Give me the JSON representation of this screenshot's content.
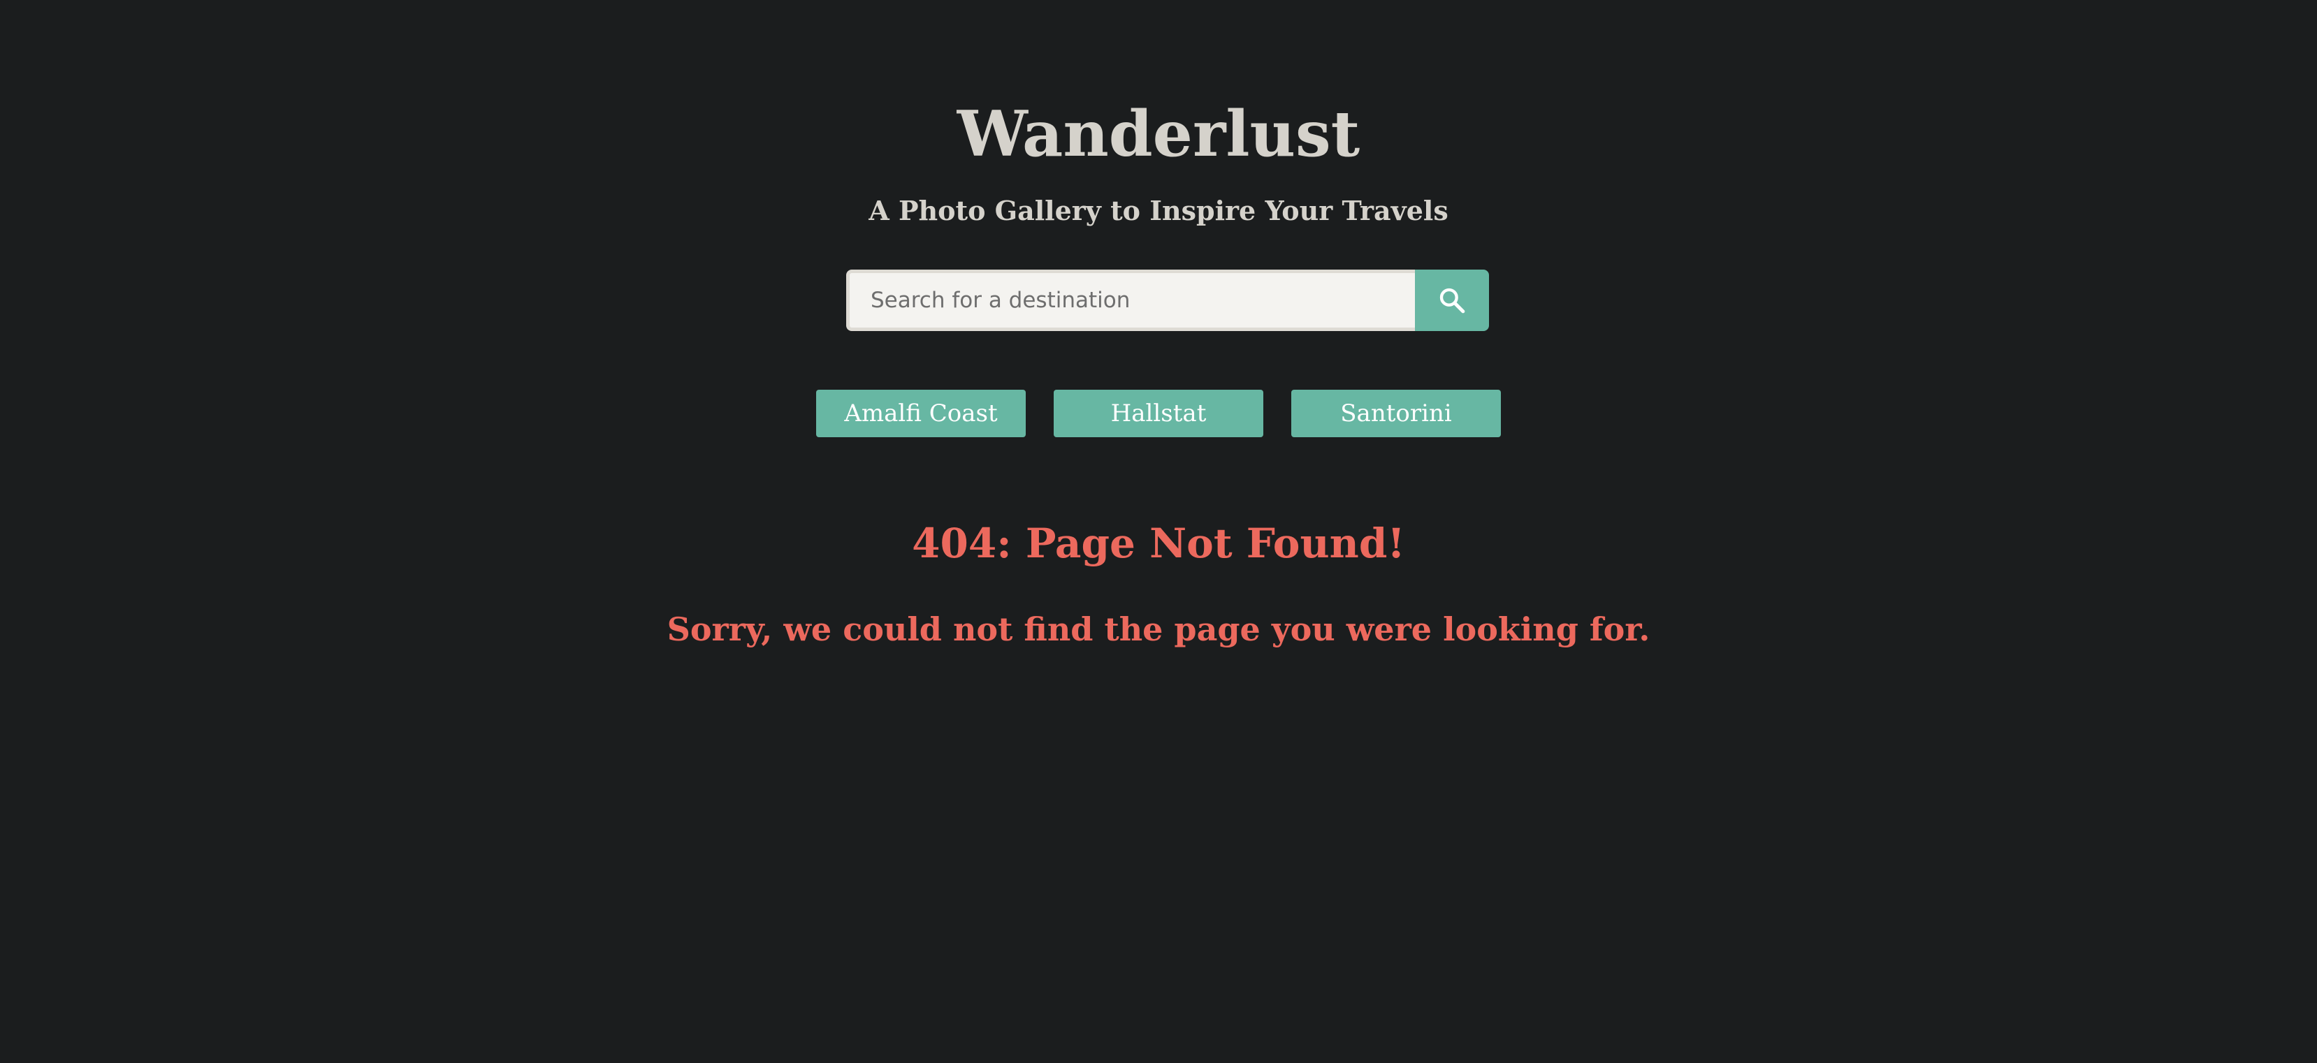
{
  "header": {
    "title": "Wanderlust",
    "subtitle": "A Photo Gallery to Inspire Your Travels"
  },
  "search": {
    "placeholder": "Search for a destination",
    "value": "",
    "button_icon": "search-icon"
  },
  "tags": [
    {
      "label": "Amalfi Coast"
    },
    {
      "label": "Hallstat"
    },
    {
      "label": "Santorini"
    }
  ],
  "error": {
    "title": "404: Page Not Found!",
    "message": "Sorry, we could not find the page you were looking for."
  },
  "colors": {
    "background": "#1b1d1e",
    "accent": "#67b7a3",
    "error": "#ec695d",
    "text": "#d5d2cb"
  }
}
